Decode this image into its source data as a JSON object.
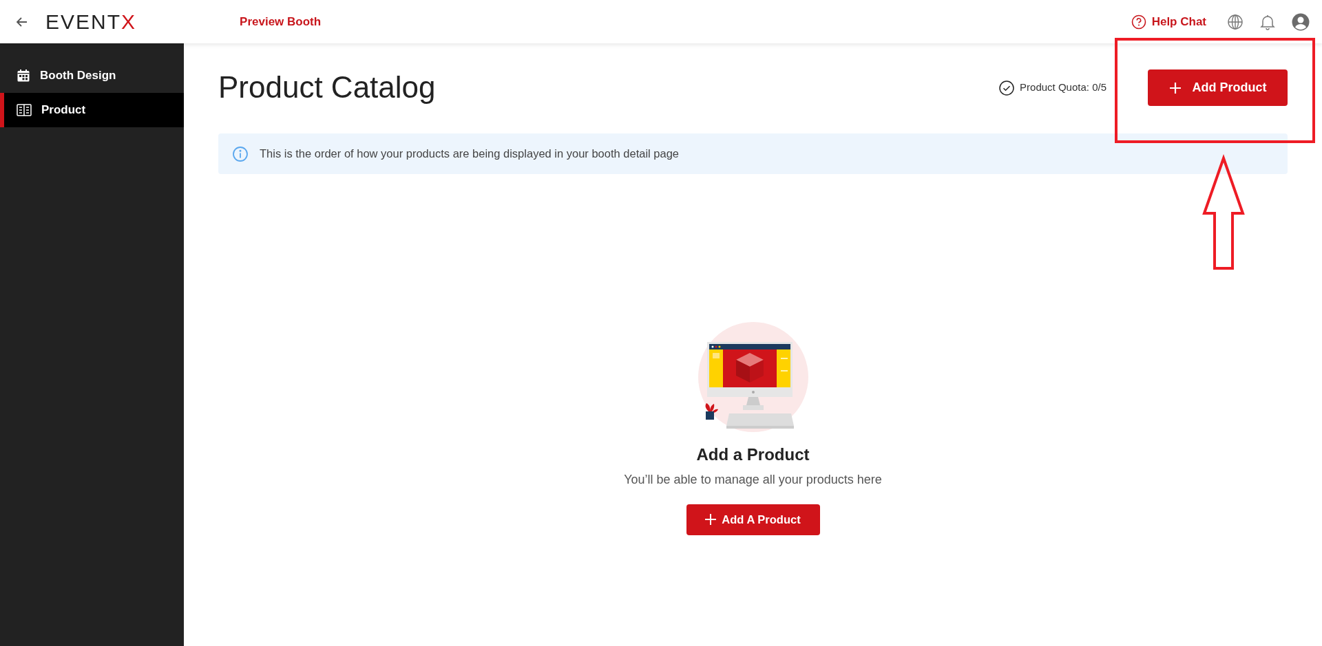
{
  "header": {
    "logo": {
      "text": "EVENT",
      "accent": "X"
    },
    "preview_link": "Preview Booth",
    "help_chat": "Help Chat"
  },
  "sidebar": {
    "items": [
      {
        "label": "Booth Design",
        "selected": false
      },
      {
        "label": "Product",
        "selected": true
      }
    ]
  },
  "page": {
    "title": "Product Catalog",
    "quota": "Product Quota: 0/5",
    "add_button": "Add Product",
    "info": "This is the order of how your products are being displayed in your booth detail page",
    "empty_state": {
      "title": "Add a Product",
      "subtitle": "You’ll be able to manage all your products here",
      "button": "Add A Product"
    }
  }
}
